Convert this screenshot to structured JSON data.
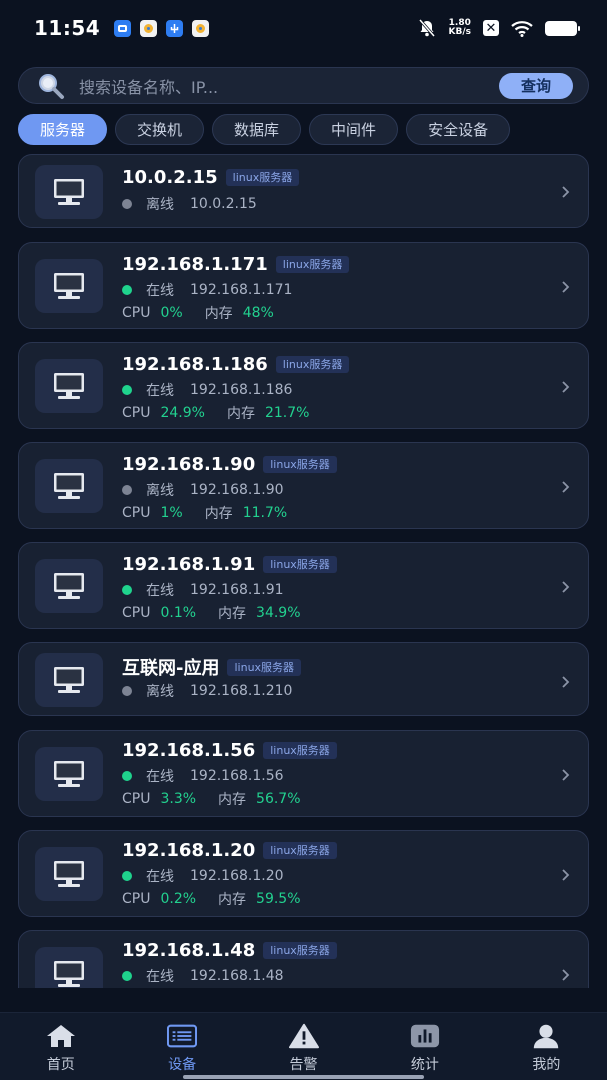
{
  "status_bar": {
    "time": "11:54",
    "net_speed_value": "1.80",
    "net_speed_unit": "KB/s",
    "icons": [
      "mute-bell-icon",
      "wifi-icon",
      "battery-icon"
    ]
  },
  "search": {
    "placeholder": "搜索设备名称、IP...",
    "button_label": "查询"
  },
  "tabs": [
    {
      "label": "服务器",
      "active": true
    },
    {
      "label": "交换机",
      "active": false
    },
    {
      "label": "数据库",
      "active": false
    },
    {
      "label": "中间件",
      "active": false
    },
    {
      "label": "安全设备",
      "active": false
    }
  ],
  "labels": {
    "cpu": "CPU",
    "memory": "内存"
  },
  "devices": [
    {
      "name": "10.0.2.15",
      "tag": "linux服务器",
      "status": "离线",
      "online": false,
      "ip": "10.0.2.15"
    },
    {
      "name": "192.168.1.171",
      "tag": "linux服务器",
      "status": "在线",
      "online": true,
      "ip": "192.168.1.171",
      "cpu": "0%",
      "memory": "48%"
    },
    {
      "name": "192.168.1.186",
      "tag": "linux服务器",
      "status": "在线",
      "online": true,
      "ip": "192.168.1.186",
      "cpu": "24.9%",
      "memory": "21.7%"
    },
    {
      "name": "192.168.1.90",
      "tag": "linux服务器",
      "status": "离线",
      "online": false,
      "ip": "192.168.1.90",
      "cpu": "1%",
      "memory": "11.7%"
    },
    {
      "name": "192.168.1.91",
      "tag": "linux服务器",
      "status": "在线",
      "online": true,
      "ip": "192.168.1.91",
      "cpu": "0.1%",
      "memory": "34.9%"
    },
    {
      "name": "互联网-应用",
      "tag": "linux服务器",
      "status": "离线",
      "online": false,
      "ip": "192.168.1.210"
    },
    {
      "name": "192.168.1.56",
      "tag": "linux服务器",
      "status": "在线",
      "online": true,
      "ip": "192.168.1.56",
      "cpu": "3.3%",
      "memory": "56.7%"
    },
    {
      "name": "192.168.1.20",
      "tag": "linux服务器",
      "status": "在线",
      "online": true,
      "ip": "192.168.1.20",
      "cpu": "0.2%",
      "memory": "59.5%"
    },
    {
      "name": "192.168.1.48",
      "tag": "linux服务器",
      "status": "在线",
      "online": true,
      "ip": "192.168.1.48"
    }
  ],
  "bottom_nav": [
    {
      "label": "首页",
      "icon": "home-icon",
      "active": false
    },
    {
      "label": "设备",
      "icon": "device-list-icon",
      "active": true
    },
    {
      "label": "告警",
      "icon": "warning-icon",
      "active": false
    },
    {
      "label": "统计",
      "icon": "stats-icon",
      "active": false
    },
    {
      "label": "我的",
      "icon": "profile-icon",
      "active": false
    }
  ],
  "colors": {
    "accent": "#6f98f2",
    "online": "#1fd38d",
    "offline": "#7d8494",
    "metric": "#22d18f"
  }
}
